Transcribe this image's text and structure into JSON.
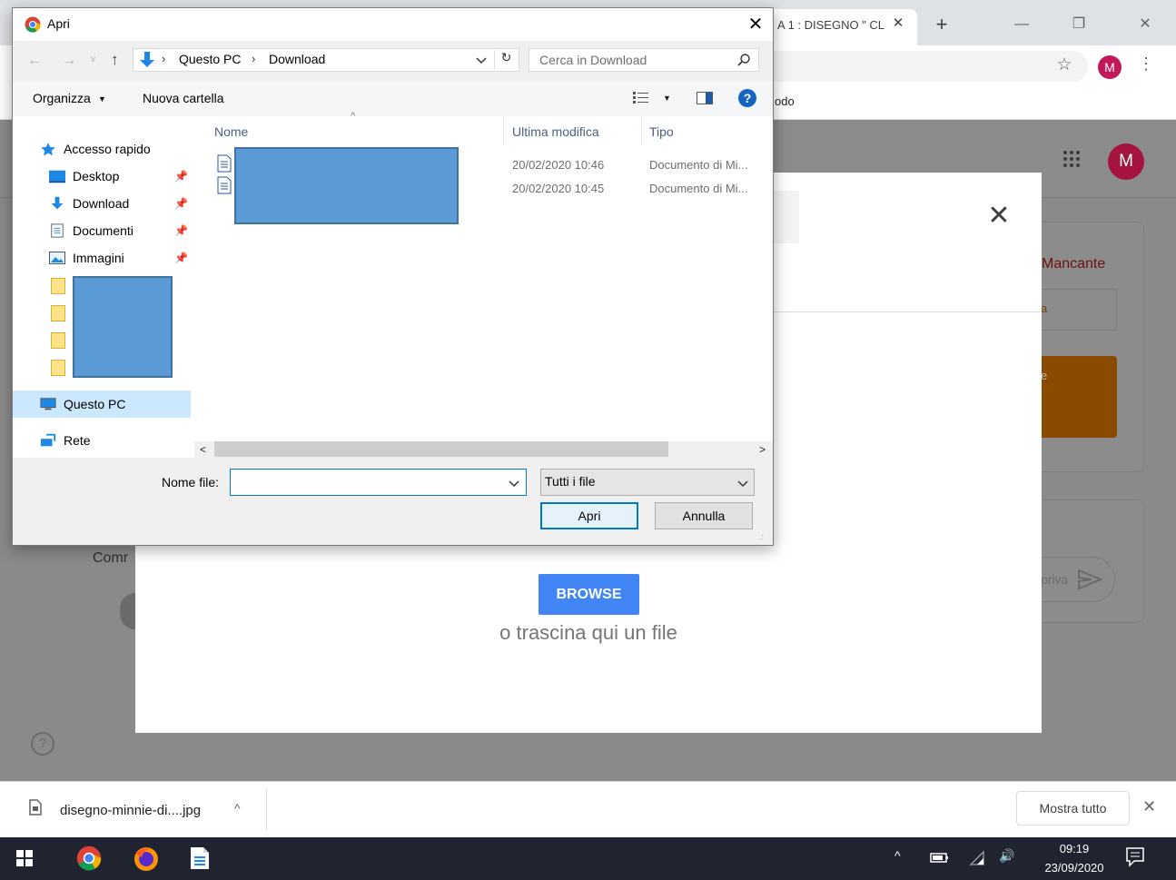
{
  "browser": {
    "tab_title": "A 1 : DISEGNO \" CL",
    "tab_close": "✕",
    "new_tab": "+",
    "minimize": "—",
    "maximize": "❐",
    "close": "✕",
    "star": "☆",
    "avatar_initial": "M",
    "menu": "⋮",
    "bookmark_partial": "odo"
  },
  "page": {
    "avatar_initial": "M",
    "status_label": "Mancante",
    "partial_letter_a": "a",
    "partial_letter_e": "e",
    "comment_label": "Comr",
    "send_placeholder": "priva",
    "help": "?",
    "colors": {
      "overlay": "#8a8a8a",
      "status_red": "#6e0f0f",
      "orange": "#8a4a00",
      "avatar": "#a5133f"
    }
  },
  "upload_modal": {
    "close": "✕",
    "browse_label": "BROWSE",
    "drop_text": "o trascina qui un file",
    "colors": {
      "browse": "#4285f4"
    }
  },
  "file_dialog": {
    "title": "Apri",
    "close": "✕",
    "nav": {
      "back": "←",
      "forward": "→",
      "recent": "v",
      "up": "↑"
    },
    "address": {
      "sep": "›",
      "crumbs": [
        "Questo PC",
        "Download"
      ],
      "refresh": "↻"
    },
    "search_placeholder": "Cerca in Download",
    "toolbar": {
      "organize": "Organizza",
      "caret": "▼",
      "new_folder": "Nuova cartella",
      "help": "?"
    },
    "nav_pane": {
      "quick_access": "Accesso rapido",
      "items": [
        {
          "label": "Desktop",
          "pin": "📌"
        },
        {
          "label": "Download",
          "pin": "📌"
        },
        {
          "label": "Documenti",
          "pin": "📌"
        },
        {
          "label": "Immagini",
          "pin": "📌"
        }
      ],
      "this_pc": "Questo PC",
      "network": "Rete"
    },
    "columns": {
      "name": "Nome",
      "modified": "Ultima modifica",
      "type": "Tipo",
      "sort": "^"
    },
    "files": [
      {
        "modified": "20/02/2020 10:46",
        "type": "Documento di Mi..."
      },
      {
        "modified": "20/02/2020 10:45",
        "type": "Documento di Mi..."
      }
    ],
    "scroll": {
      "left": "<",
      "right": ">"
    },
    "filename_label": "Nome file:",
    "filename_value": "",
    "filetype": "Tutti i file",
    "open_button": "Apri",
    "cancel_button": "Annulla",
    "grip": ".:"
  },
  "download_bar": {
    "filename": "disegno-minnie-di....jpg",
    "caret": "^",
    "show_all": "Mostra tutto",
    "close": "✕"
  },
  "taskbar": {
    "tray_up": "^",
    "volume": "🔊",
    "time": "09:19",
    "date": "23/09/2020"
  }
}
